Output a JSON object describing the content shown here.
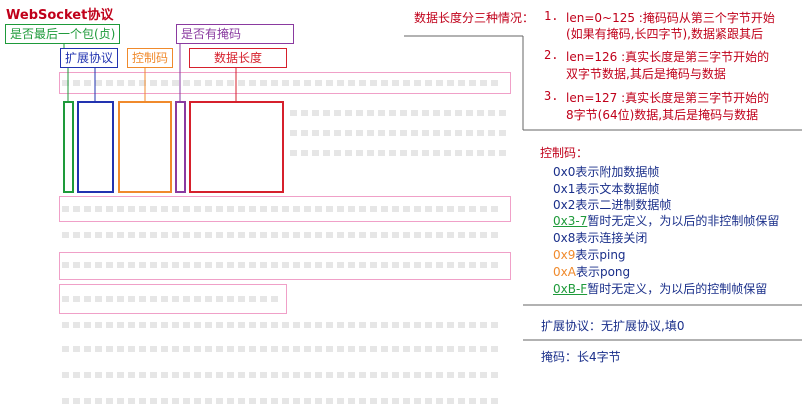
{
  "diagram": {
    "title": "WebSocket协议",
    "labels": {
      "fin": "是否最后一个包(贞)",
      "rsv": "扩展协议",
      "opcode": "控制码",
      "mask": "是否有掩码",
      "payload_len": "数据长度"
    }
  },
  "notes": {
    "length_heading": "数据长度分三种情况：",
    "cases": [
      {
        "num": "1.",
        "line1": "len=0~125 :掩码码从第三个字节开始",
        "line2": "(如果有掩码,长四字节),数据紧跟其后"
      },
      {
        "num": "2.",
        "line1": "len=126 :真实长度是第三字节开始的",
        "line2": "双字节数据,其后是掩码与数据"
      },
      {
        "num": "3.",
        "line1": "len=127 :真实长度是第三字节开始的",
        "line2": "8字节(64位)数据,其后是掩码与数据"
      }
    ],
    "opcode_heading": "控制码：",
    "opcodes": [
      {
        "code": "0x0",
        "text": "表示附加数据帧"
      },
      {
        "code": "0x1",
        "text": "表示文本数据帧"
      },
      {
        "code": "0x2",
        "text": "表示二进制数据帧"
      },
      {
        "code": "0x3-7",
        "text": "暂时无定义，为以后的非控制帧保留"
      },
      {
        "code": "0x8",
        "text": "表示连接关闭"
      },
      {
        "code": "0x9",
        "text": "表示ping"
      },
      {
        "code": "0xA",
        "text": "表示pong"
      },
      {
        "code": "0xB-F",
        "text": "暂时无定义，为以后的控制帧保留"
      }
    ],
    "rsv_note": "扩展协议：无扩展协议,填0",
    "mask_note": "掩码：长4字节"
  },
  "colors": {
    "fin": "#1e9a3a",
    "rsv": "#2233b0",
    "opcode": "#f08a2c",
    "mask": "#8a3aa0",
    "payload": "#d6202c",
    "pink": "#f0a0c8",
    "title": "#c0001a"
  }
}
